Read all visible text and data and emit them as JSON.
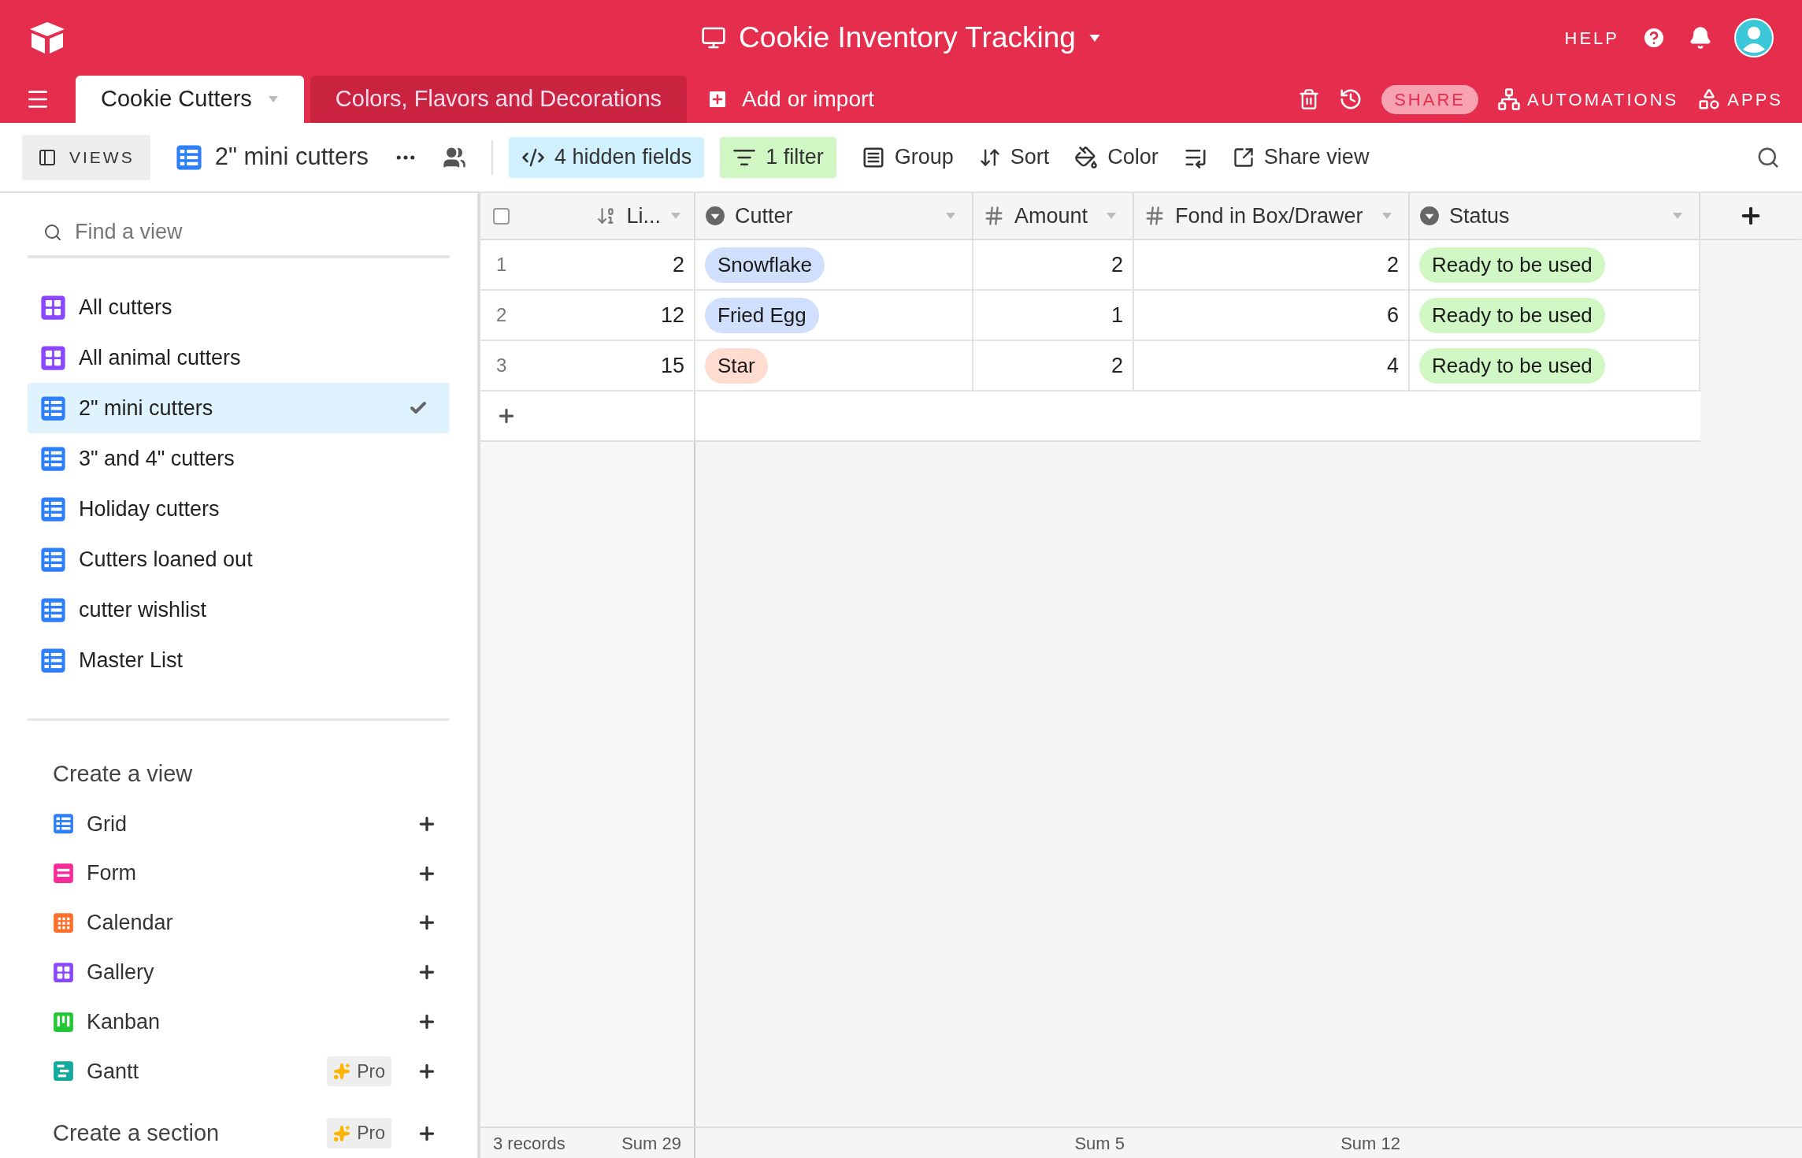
{
  "header": {
    "title": "Cookie Inventory Tracking",
    "help": "HELP",
    "share": "SHARE",
    "automations": "AUTOMATIONS",
    "apps": "APPS"
  },
  "tabs": [
    {
      "label": "Cookie Cutters",
      "selected": true
    },
    {
      "label": "Colors, Flavors and Decorations",
      "selected": false
    }
  ],
  "add_table": "Add or import",
  "toolbar": {
    "views": "VIEWS",
    "view_name": "2\" mini cutters",
    "hidden_fields": "4 hidden fields",
    "filter": "1 filter",
    "group": "Group",
    "sort": "Sort",
    "color_label": "Color",
    "share_view": "Share view"
  },
  "sidebar": {
    "search_placeholder": "Find a view",
    "views": [
      {
        "name": "All cutters",
        "kind": "gallery",
        "selected": false
      },
      {
        "name": "All animal cutters",
        "kind": "gallery",
        "selected": false
      },
      {
        "name": "2\" mini cutters",
        "kind": "grid",
        "selected": true
      },
      {
        "name": "3\" and 4\" cutters",
        "kind": "grid",
        "selected": false
      },
      {
        "name": "Holiday cutters",
        "kind": "grid",
        "selected": false
      },
      {
        "name": "Cutters loaned out",
        "kind": "grid",
        "selected": false
      },
      {
        "name": "cutter wishlist",
        "kind": "grid",
        "selected": false
      },
      {
        "name": "Master List",
        "kind": "grid",
        "selected": false
      }
    ],
    "create_title": "Create a view",
    "create_items": [
      {
        "name": "Grid",
        "kind": "grid"
      },
      {
        "name": "Form",
        "kind": "form"
      },
      {
        "name": "Calendar",
        "kind": "calendar"
      },
      {
        "name": "Gallery",
        "kind": "gallery"
      },
      {
        "name": "Kanban",
        "kind": "kanban"
      },
      {
        "name": "Gantt",
        "kind": "gantt",
        "badge": "Pro"
      }
    ],
    "create_section": {
      "label": "Create a section",
      "badge": "Pro"
    }
  },
  "table": {
    "select_all_checked": false,
    "columns": [
      {
        "name": "Li...",
        "kind": "number"
      },
      {
        "name": "Cutter",
        "kind": "select"
      },
      {
        "name": "Amount",
        "kind": "count"
      },
      {
        "name": "Fond in Box/Drawer",
        "kind": "count"
      },
      {
        "name": "Status",
        "kind": "select"
      }
    ],
    "rows": [
      {
        "num": "1",
        "li": "2",
        "cutter": {
          "text": "Snowflake",
          "color": "#d0e0fc"
        },
        "amount": "2",
        "fond": "2",
        "status": {
          "text": "Ready to be used",
          "color": "#d1f7c4"
        }
      },
      {
        "num": "2",
        "li": "12",
        "cutter": {
          "text": "Fried Egg",
          "color": "#d0e0fc"
        },
        "amount": "1",
        "fond": "6",
        "status": {
          "text": "Ready to be used",
          "color": "#d1f7c4"
        }
      },
      {
        "num": "3",
        "li": "15",
        "cutter": {
          "text": "Star",
          "color": "#ffdcd0"
        },
        "amount": "2",
        "fond": "4",
        "status": {
          "text": "Ready to be used",
          "color": "#d1f7c4"
        }
      }
    ]
  },
  "footer": {
    "records": "3 records",
    "sum_li": "Sum 29",
    "sum_amount": "Sum 5",
    "sum_fond": "Sum 12"
  }
}
